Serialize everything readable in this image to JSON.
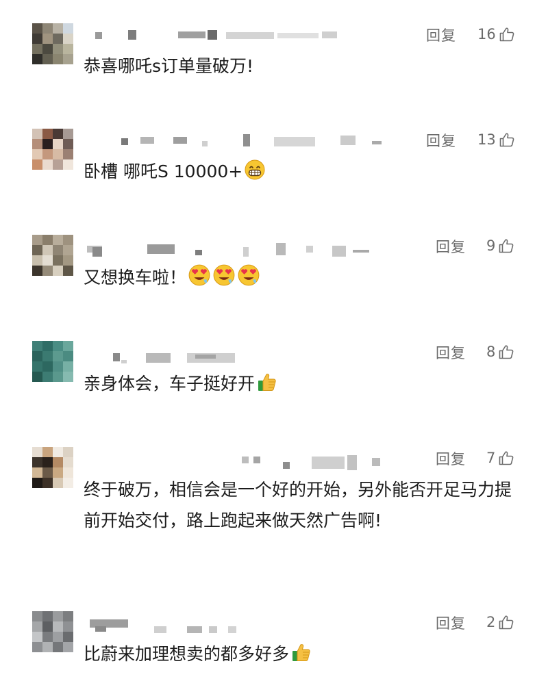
{
  "comments": [
    {
      "reply": "回复",
      "likes": "16",
      "text": "恭喜哪吒s订单量破万!",
      "emojis": []
    },
    {
      "reply": "回复",
      "likes": "13",
      "text": "卧槽 哪吒S 10000+",
      "emojis": [
        "grin-emoji"
      ]
    },
    {
      "reply": "回复",
      "likes": "9",
      "text": "又想换车啦！",
      "emojis": [
        "heart-eyes-emoji",
        "heart-eyes-emoji",
        "heart-eyes-emoji"
      ]
    },
    {
      "reply": "回复",
      "likes": "8",
      "text": "亲身体会，车子挺好开",
      "emojis": [
        "thumbs-up-emoji"
      ]
    },
    {
      "reply": "回复",
      "likes": "7",
      "text": "终于破万，相信会是一个好的开始，另外能否开足马力提前开始交付，路上跑起来做天然广告啊!",
      "emojis": []
    },
    {
      "reply": "回复",
      "likes": "2",
      "text": "比蔚来加理想卖的都多好多",
      "emojis": [
        "thumbs-up-emoji"
      ]
    }
  ],
  "icons": {
    "like": "thumbs-up-outline-icon"
  },
  "colors": {
    "text": "#1c1c1c",
    "meta": "#6b6b6b",
    "background": "#ffffff"
  }
}
